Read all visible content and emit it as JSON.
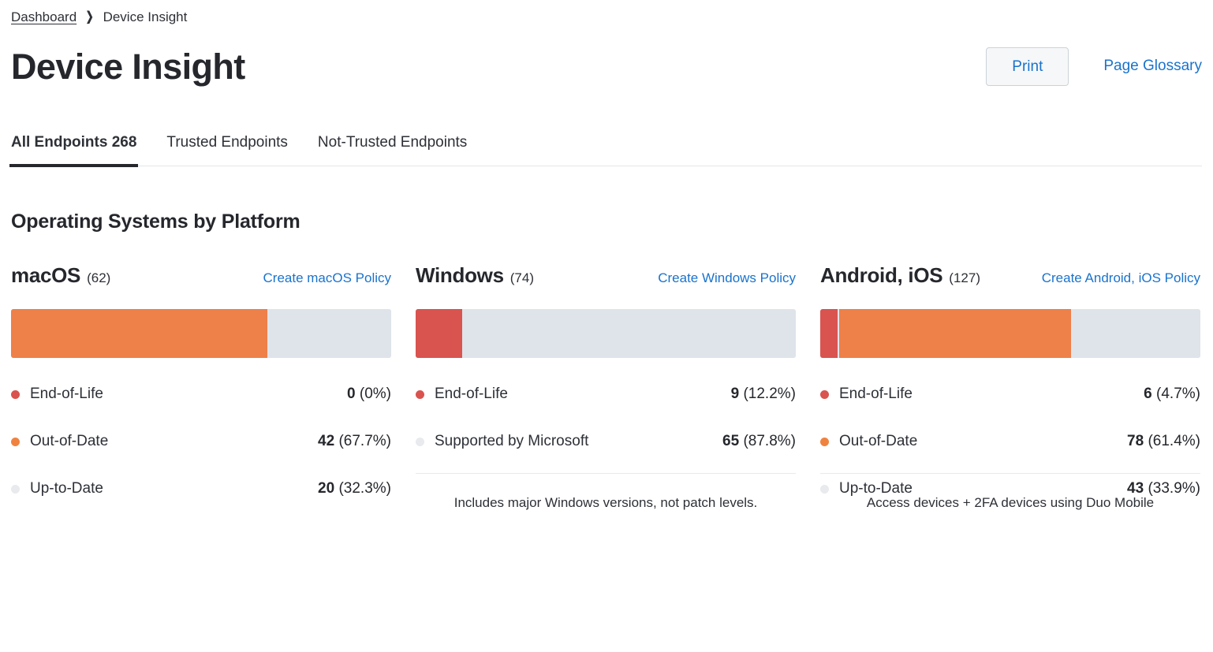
{
  "breadcrumb": {
    "parent": "Dashboard",
    "separator": "❯",
    "current": "Device Insight"
  },
  "header": {
    "title": "Device Insight",
    "print_label": "Print",
    "glossary_label": "Page Glossary"
  },
  "tabs": [
    {
      "label": "All Endpoints 268",
      "active": true
    },
    {
      "label": "Trusted Endpoints",
      "active": false
    },
    {
      "label": "Not-Trusted Endpoints",
      "active": false
    }
  ],
  "section": {
    "title": "Operating Systems by Platform"
  },
  "colors": {
    "end_of_life": "#d9534f",
    "out_of_date": "#ee8049",
    "up_to_date": "#dfe4ea",
    "supported": "#dfe4ea",
    "link": "#1a73cc",
    "text": "#2d3036"
  },
  "platforms": [
    {
      "name": "macOS",
      "count": "(62)",
      "link": "Create macOS Policy",
      "segments": [
        {
          "key": "eol",
          "pct": 0
        },
        {
          "key": "ood",
          "pct": 67.7
        },
        {
          "key": "utd",
          "pct": 32.3
        }
      ],
      "legend": [
        {
          "key": "eol",
          "label": "End-of-Life",
          "count": "0",
          "pct": "(0%)"
        },
        {
          "key": "ood",
          "label": "Out-of-Date",
          "count": "42",
          "pct": "(67.7%)"
        },
        {
          "key": "utd",
          "label": "Up-to-Date",
          "count": "20",
          "pct": "(32.3%)"
        }
      ],
      "note": "",
      "show_rule": false
    },
    {
      "name": "Windows",
      "count": "(74)",
      "link": "Create Windows Policy",
      "segments": [
        {
          "key": "eol",
          "pct": 12.2
        },
        {
          "key": "sup",
          "pct": 87.8
        }
      ],
      "legend": [
        {
          "key": "eol",
          "label": "End-of-Life",
          "count": "9",
          "pct": "(12.2%)"
        },
        {
          "key": "sup",
          "label": "Supported by Microsoft",
          "count": "65",
          "pct": "(87.8%)"
        }
      ],
      "note": "Includes major Windows versions, not patch levels.",
      "show_rule": true
    },
    {
      "name": "Android, iOS",
      "count": "(127)",
      "link": "Create Android, iOS Policy",
      "segments": [
        {
          "key": "eol",
          "pct": 4.7
        },
        {
          "key": "ood",
          "pct": 61.4
        },
        {
          "key": "utd",
          "pct": 33.9
        }
      ],
      "legend": [
        {
          "key": "eol",
          "label": "End-of-Life",
          "count": "6",
          "pct": "(4.7%)"
        },
        {
          "key": "ood",
          "label": "Out-of-Date",
          "count": "78",
          "pct": "(61.4%)"
        },
        {
          "key": "utd",
          "label": "Up-to-Date",
          "count": "43",
          "pct": "(33.9%)"
        }
      ],
      "note": "Access devices + 2FA devices using Duo Mobile",
      "show_rule": true
    }
  ],
  "chart_data": {
    "type": "bar",
    "title": "Operating Systems by Platform",
    "categories": [
      "macOS",
      "Windows",
      "Android, iOS"
    ],
    "totals": [
      62,
      74,
      127
    ],
    "grand_total": 268,
    "series": [
      {
        "name": "End-of-Life",
        "values": [
          0,
          9,
          6
        ],
        "percents": [
          0,
          12.2,
          4.7
        ],
        "color": "#d9534f"
      },
      {
        "name": "Out-of-Date",
        "values": [
          42,
          null,
          78
        ],
        "percents": [
          67.7,
          null,
          61.4
        ],
        "color": "#ee8049"
      },
      {
        "name": "Supported by Microsoft",
        "values": [
          null,
          65,
          null
        ],
        "percents": [
          null,
          87.8,
          null
        ],
        "color": "#dfe4ea"
      },
      {
        "name": "Up-to-Date",
        "values": [
          20,
          null,
          43
        ],
        "percents": [
          32.3,
          null,
          33.9
        ],
        "color": "#dfe4ea"
      }
    ],
    "stacked": true,
    "orientation": "horizontal",
    "grid": false,
    "legend_position": "below-each-bar"
  }
}
